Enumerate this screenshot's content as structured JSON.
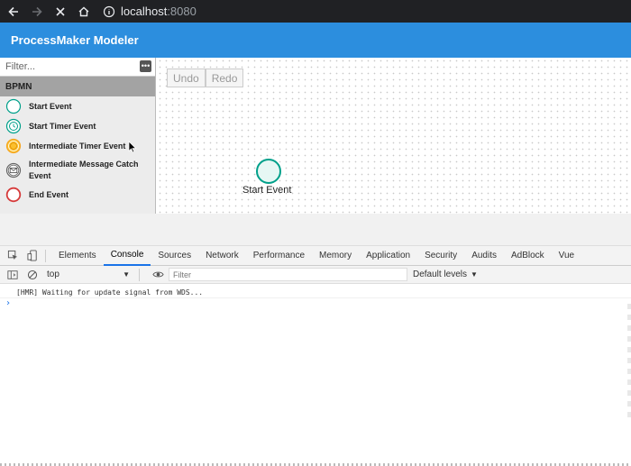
{
  "browser": {
    "url_host": "localhost",
    "url_port": ":8080"
  },
  "app": {
    "title": "ProcessMaker Modeler"
  },
  "sidebar": {
    "filter_placeholder": "Filter...",
    "category": "BPMN",
    "items": [
      {
        "label": "Start Event",
        "icon": "start-event-icon"
      },
      {
        "label": "Start Timer Event",
        "icon": "start-timer-event-icon"
      },
      {
        "label": "Intermediate Timer Event",
        "icon": "intermediate-timer-event-icon"
      },
      {
        "label": "Intermediate Message Catch Event",
        "icon": "intermediate-message-catch-event-icon"
      },
      {
        "label": "End Event",
        "icon": "end-event-icon"
      }
    ]
  },
  "canvas": {
    "undo_label": "Undo",
    "redo_label": "Redo",
    "node_label": "Start Event"
  },
  "devtools": {
    "tabs": [
      "Elements",
      "Console",
      "Sources",
      "Network",
      "Performance",
      "Memory",
      "Application",
      "Security",
      "Audits",
      "AdBlock",
      "Vue"
    ],
    "active_tab": "Console",
    "context": "top",
    "filter_placeholder": "Filter",
    "levels": "Default levels",
    "log_line": "[HMR] Waiting for update signal from WDS...",
    "prompt": "›"
  },
  "colors": {
    "header": "#2c8ede",
    "start_event": "#00a08a",
    "end_event": "#d63a3a",
    "timer": "#f5a623"
  }
}
